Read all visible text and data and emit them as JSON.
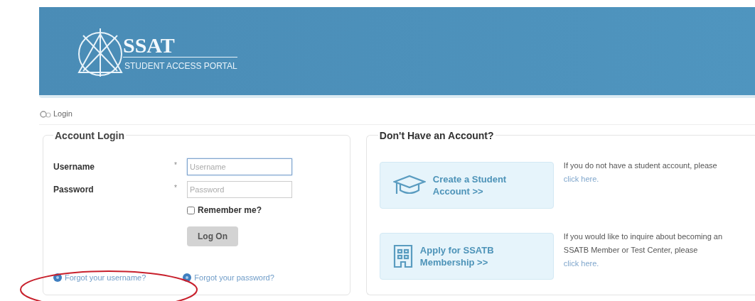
{
  "header": {
    "logo_title": "SSAT",
    "logo_subtitle": "STUDENT ACCESS PORTAL"
  },
  "breadcrumb": {
    "label": "Login"
  },
  "login": {
    "title": "Account Login",
    "fields": [
      {
        "label": "Username",
        "required_mark": "*",
        "placeholder": "Username",
        "focused": true
      },
      {
        "label": "Password",
        "required_mark": "*",
        "placeholder": "Password",
        "focused": false
      }
    ],
    "remember": {
      "label": "Remember me?",
      "checked": false
    },
    "submit": "Log On",
    "links": [
      "Forgot your username?",
      "Forgot your password?"
    ]
  },
  "signup": {
    "title": "Don't Have an Account?",
    "options": [
      {
        "kind": "student",
        "button": "Create a Student Account >>",
        "text": "If you do not have a student account, please",
        "link": "click here."
      },
      {
        "kind": "member",
        "button": "Apply for SSATB Membership >>",
        "text": "If you would like to inquire about becoming an SSATB Member or Test Center, please",
        "link": "click here."
      }
    ]
  },
  "annotation": {
    "kind": "ellipse"
  }
}
